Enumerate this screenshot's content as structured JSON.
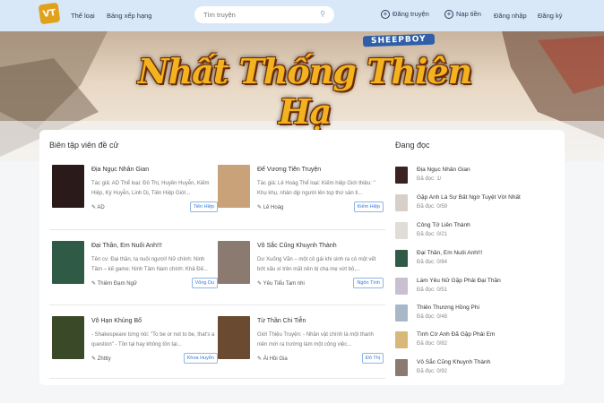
{
  "header": {
    "logo_text": "VT",
    "nav": [
      "Thể loại",
      "Bảng xếp hạng"
    ],
    "search_placeholder": "Tìm truyện",
    "actions": [
      "Đăng truyện",
      "Nạp tiền",
      "Đăng nhập",
      "Đăng ký"
    ]
  },
  "banner": {
    "subtitle": "SHEEPBOY",
    "title": "Nhất Thống Thiên Hạ"
  },
  "editors_pick": {
    "title": "Biên tập viên đề cử",
    "cards": [
      {
        "title": "Địa Ngục Nhân Gian",
        "desc": "Tác giả: AD Thể loại: Đô Thị, Huyền Huyễn, Kiếm Hiệp, Kỳ Huyễn, Linh Dị, Tiên Hiệp Giới...",
        "author": "AD",
        "tag": "Tiên Hiệp",
        "cover": "#2a1a1a"
      },
      {
        "title": "Đế Vương Tiên Truyện",
        "desc": "Tác giả: Lê Hoàg Thể loại: Kiếm hiệp Giới thiệu: \" Khụ khụ, nhân dịp người lên top thứ sân ti...",
        "author": "Lê Hoàg",
        "tag": "Kiếm Hiệp",
        "cover": "#c9a27a"
      },
      {
        "title": "Đại Thần, Em Nuôi Anh!!!",
        "desc": "Tên cv: Đại thần, ta nuôi ngươi! Nữ chính: Ninh Tâm – kế game: Ninh Tâm Nam chính: Khả Đế...",
        "author": "Thiêm Đạm Ngữ",
        "tag": "Võng Du",
        "cover": "#2f5a45"
      },
      {
        "title": "Vô Sắc Cũng Khuynh Thành",
        "desc": "Dư Xuống Vãn – một cô gái khi sinh ra có một vết bớt xấu xí trên mặt nên bị cha mẹ vứt bỏ,...",
        "author": "Yêu Tiểu Tam nhi",
        "tag": "Ngôn Tình",
        "cover": "#8a7a70"
      },
      {
        "title": "Vô Hạn Khủng Bố",
        "desc": "- Shakespeare từng nói: \"To be or not to be, that's a question\" - Tồn tại hay không tồn tại...",
        "author": "Zhttty",
        "tag": "Khoa Huyễn",
        "cover": "#3a4a28"
      },
      {
        "title": "Từ Thần Chi Tiễn",
        "desc": "Giới Thiệu Truyện: - Nhân vật chính là một thanh niên mới ra trường làm một công việc...",
        "author": "Ái Hồi Gia",
        "tag": "Đô Thị",
        "cover": "#6a4a30"
      }
    ]
  },
  "reading": {
    "title": "Đang đọc",
    "items": [
      {
        "title": "Địa Ngục Nhân Gian",
        "progress": "Đã đọc: 1/",
        "cover": "#3a2222"
      },
      {
        "title": "Gặp Anh Là Sự Bất Ngờ Tuyệt Vời Nhất",
        "progress": "Đã đọc: 0/59",
        "cover": "#d8d0c8"
      },
      {
        "title": "Công Tử Liên Thành",
        "progress": "Đã đọc: 0/21",
        "cover": "#e0dcd8"
      },
      {
        "title": "Đại Thần, Em Nuôi Anh!!!",
        "progress": "Đã đọc: 0/84",
        "cover": "#2f5a45"
      },
      {
        "title": "Làm Yêu Nữ Gặp Phải Đại Thần",
        "progress": "Đã đọc: 0/51",
        "cover": "#c8c0d0"
      },
      {
        "title": "Thiên Thương Hồng Phi",
        "progress": "Đã đọc: 0/48",
        "cover": "#a8b8c8"
      },
      {
        "title": "Tình Cờ Anh Đã Gặp Phải Em",
        "progress": "Đã đọc: 0/82",
        "cover": "#d8b878"
      },
      {
        "title": "Vô Sắc Cũng Khuynh Thành",
        "progress": "Đã đọc: 0/92",
        "cover": "#8a7a70"
      }
    ]
  }
}
